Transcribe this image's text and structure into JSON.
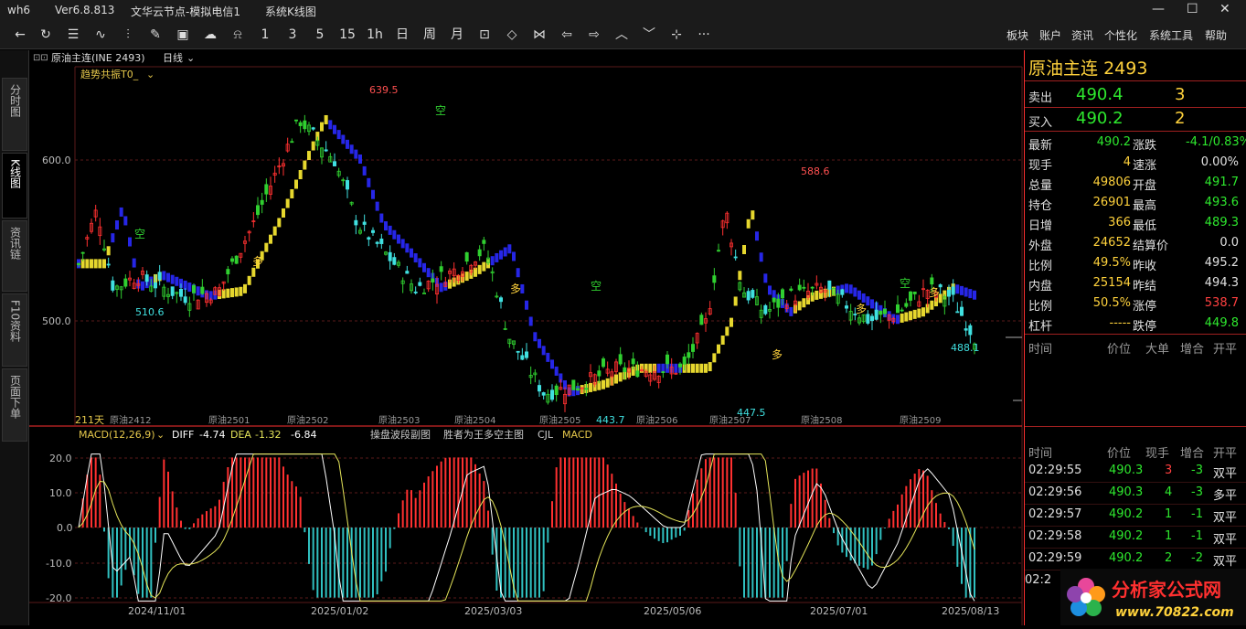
{
  "window": {
    "app": "wh6",
    "version": "Ver6.8.813",
    "server": "文华云节点-模拟电信1",
    "view": "系统K线图",
    "controls": [
      "—",
      "☐",
      "✕"
    ]
  },
  "toolbar": {
    "period_buttons": [
      "1",
      "3",
      "5",
      "15",
      "1h",
      "日",
      "周",
      "月"
    ],
    "menus": [
      "板块",
      "账户",
      "资讯",
      "个性化",
      "系统工具",
      "帮助"
    ]
  },
  "sidebar": {
    "tabs": [
      "分时图",
      "K线图",
      "资讯链",
      "F10资料",
      "页面下单"
    ]
  },
  "chart": {
    "instrument": "原油主连(INE 2493)",
    "period": "日线",
    "indicator_name": "趋势共振T0_",
    "bar_count": "211天",
    "annotations": {
      "high1": "639.5",
      "low1": "510.6",
      "low2": "443.7",
      "low3": "447.5",
      "high2": "588.6",
      "last": "488.1"
    },
    "price_ticks": [
      "600.0",
      "500.0"
    ],
    "contracts": [
      "原油2412",
      "原油2501",
      "原油2502",
      "原油2503",
      "原油2504",
      "原油2505",
      "原油2506",
      "原油2507",
      "原油2508",
      "原油2509"
    ],
    "dates": [
      "2024/11/01",
      "2025/01/02",
      "2025/03/03",
      "2025/05/06",
      "2025/07/01",
      "2025/08/13"
    ],
    "marker_bull": "多",
    "marker_bear": "空"
  },
  "macd": {
    "label": "MACD(12,26,9)",
    "diff_label": "DIFF",
    "diff": "-4.74",
    "dea_label": "DEA",
    "dea": "-1.32",
    "macd_val": "-6.84",
    "tabs": [
      "操盘波段副图",
      "胜者为王多空主图",
      "CJL",
      "MACD"
    ],
    "ticks": [
      "20.0",
      "10.0",
      "0.0",
      "-10.0",
      "-20.0"
    ],
    "colors": {
      "diff": "#ffffff",
      "dea": "#e6e65a",
      "pos": "#ff3030",
      "neg": "#30c0c0"
    }
  },
  "quote": {
    "title": "原油主连",
    "code": "2493",
    "ask_label": "卖出",
    "ask_price": "490.4",
    "ask_vol": "3",
    "bid_label": "买入",
    "bid_price": "490.2",
    "bid_vol": "2",
    "rows": [
      {
        "l1": "最新",
        "v1": "490.2",
        "c1": "green",
        "l2": "涨跌",
        "v2": "-4.1/0.83%",
        "c2": "green"
      },
      {
        "l1": "现手",
        "v1": "4",
        "c1": "yellow",
        "l2": "速涨",
        "v2": "0.00%",
        "c2": "white"
      },
      {
        "l1": "总量",
        "v1": "49806",
        "c1": "yellow",
        "l2": "开盘",
        "v2": "491.7",
        "c2": "green"
      },
      {
        "l1": "持仓",
        "v1": "26901",
        "c1": "yellow",
        "l2": "最高",
        "v2": "493.6",
        "c2": "green"
      },
      {
        "l1": "日增",
        "v1": "366",
        "c1": "yellow",
        "l2": "最低",
        "v2": "489.3",
        "c2": "green"
      },
      {
        "l1": "外盘",
        "v1": "24652",
        "c1": "yellow",
        "l2": "结算价",
        "v2": "0.0",
        "c2": "white"
      },
      {
        "l1": "比例",
        "v1": "49.5%",
        "c1": "yellow",
        "l2": "昨收",
        "v2": "495.2",
        "c2": "white"
      },
      {
        "l1": "内盘",
        "v1": "25154",
        "c1": "yellow",
        "l2": "昨结",
        "v2": "494.3",
        "c2": "white"
      },
      {
        "l1": "比例",
        "v1": "50.5%",
        "c1": "yellow",
        "l2": "涨停",
        "v2": "538.7",
        "c2": "red"
      },
      {
        "l1": "杠杆",
        "v1": "-----",
        "c1": "yellow",
        "l2": "跌停",
        "v2": "449.8",
        "c2": "green"
      }
    ],
    "tick_headers": [
      "时间",
      "价位",
      "大单",
      "增合",
      "开平"
    ],
    "trade_headers": [
      "时间",
      "价位",
      "现手",
      "增合",
      "开平"
    ],
    "trades": [
      {
        "time": "02:29:55",
        "price": "490.3",
        "vol": "3",
        "vc": "red",
        "chg": "-3",
        "type": "双平"
      },
      {
        "time": "02:29:56",
        "price": "490.3",
        "vol": "4",
        "vc": "green",
        "chg": "-3",
        "type": "多平"
      },
      {
        "time": "02:29:57",
        "price": "490.2",
        "vol": "1",
        "vc": "green",
        "chg": "-1",
        "type": "双平"
      },
      {
        "time": "02:29:58",
        "price": "490.2",
        "vol": "1",
        "vc": "green",
        "chg": "-1",
        "type": "双平"
      },
      {
        "time": "02:29:59",
        "price": "490.2",
        "vol": "2",
        "vc": "green",
        "chg": "-2",
        "type": "双平"
      }
    ],
    "partial_time": "02:2"
  },
  "watermark": {
    "text": "分析家公式网",
    "url": "www.70822.com"
  }
}
